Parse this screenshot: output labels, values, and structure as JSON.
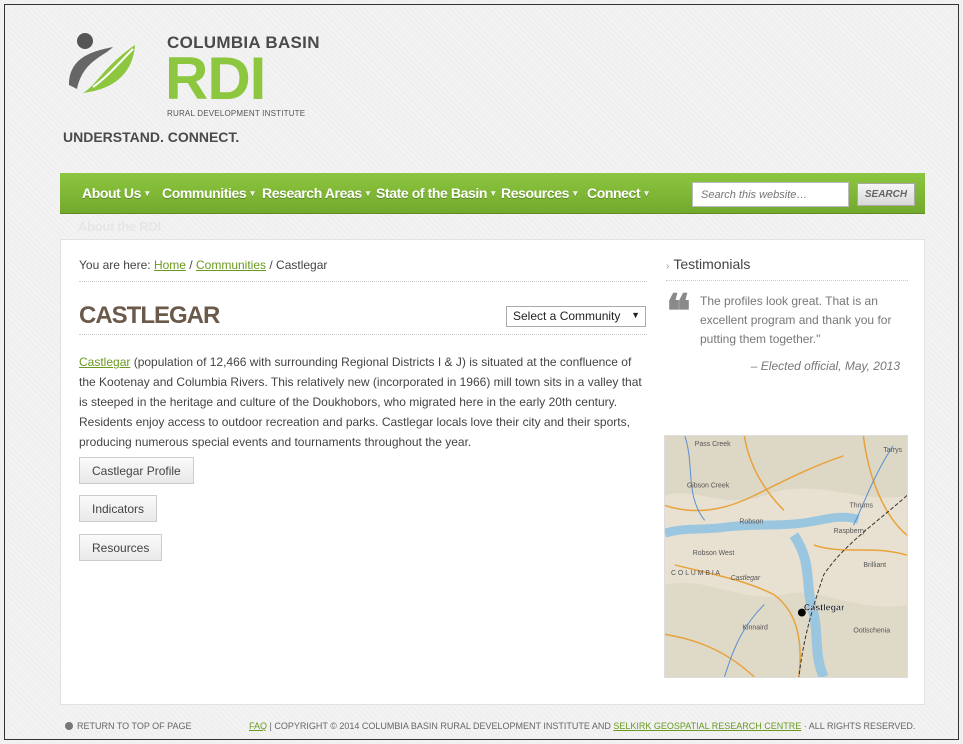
{
  "header": {
    "brand_top": "COLUMBIA BASIN",
    "brand_main": "RDI",
    "brand_sub": "RURAL DEVELOPMENT INSTITUTE",
    "tagline": "UNDERSTAND. CONNECT."
  },
  "nav": {
    "items": [
      {
        "label": "About Us"
      },
      {
        "label": "Communities"
      },
      {
        "label": "Research Areas"
      },
      {
        "label": "State of the Basin"
      },
      {
        "label": "Resources"
      },
      {
        "label": "Connect"
      }
    ],
    "search_placeholder": "Search this website…",
    "search_button": "SEARCH",
    "subnav_text": "About the RDI"
  },
  "breadcrumb": {
    "prefix": "You are here: ",
    "home": "Home",
    "sep1": " / ",
    "communities": "Communities",
    "sep2": " / ",
    "current": "Castlegar"
  },
  "main": {
    "title": "CASTLEGAR",
    "select_value": "Select a Community",
    "intro_link": "Castlegar",
    "intro_text": " (population of 12,466 with surrounding Regional Districts I & J) is situated at the confluence of the Kootenay and Columbia Rivers.  This relatively new (incorporated in 1966) mill town sits in a valley that is steeped in the heritage and culture of the Doukhobors, who migrated here in the early 20th century. Residents enjoy access to outdoor recreation and parks. Castlegar locals love their city and their sports, producing numerous special events and tournaments throughout the year.",
    "buttons": [
      "Castlegar Profile",
      "Indicators",
      "Resources"
    ]
  },
  "sidebar": {
    "widget_title": "Testimonials",
    "quote": "The profiles look great. That is an excellent program and thank you for putting them together.\"",
    "attribution": "– Elected official, May, 2013",
    "map_labels": {
      "pass_creek": "Pass Creek",
      "tarrys": "Tarrys",
      "gibson_creek": "Gibson Creek",
      "thrums": "Thrums",
      "robson": "Robson",
      "raspberry": "Raspberry",
      "robson_west": "Robson West",
      "brilliant": "Brilliant",
      "castlegar": "Castlegar",
      "castlegar_small": "Castlegar",
      "kinnaird": "Kinnaird",
      "ootischenia": "Ootischenia",
      "columbia": "C O L U M B I A"
    }
  },
  "footer": {
    "top_link": "RETURN TO TOP OF PAGE",
    "faq": "FAQ",
    "copyright": " | COPYRIGHT © 2014 COLUMBIA BASIN RURAL DEVELOPMENT INSTITUTE AND ",
    "partner": "SELKIRK GEOSPATIAL RESEARCH CENTRE",
    "rights": " · ALL RIGHTS RESERVED."
  }
}
